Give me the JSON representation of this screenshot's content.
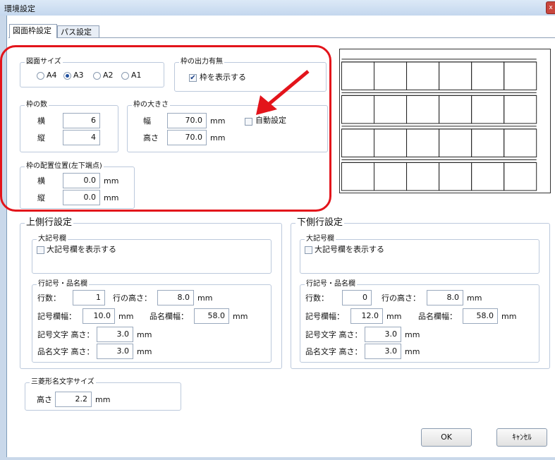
{
  "window": {
    "title": "環境設定",
    "close_label": "x"
  },
  "tabs": [
    {
      "label": "図面枠設定",
      "active": true
    },
    {
      "label": "パス設定",
      "active": false
    }
  ],
  "paper_size": {
    "legend": "図面サイズ",
    "options": [
      "A4",
      "A3",
      "A2",
      "A1"
    ],
    "selected": "A3"
  },
  "frame_output": {
    "legend": "枠の出力有無",
    "checkbox_label": "枠を表示する",
    "checked": true
  },
  "frame_count": {
    "legend": "枠の数",
    "horizontal_label": "横",
    "horizontal_value": "6",
    "vertical_label": "縦",
    "vertical_value": "4"
  },
  "frame_size": {
    "legend": "枠の大きさ",
    "width_label": "幅",
    "width_value": "70.0",
    "height_label": "高さ",
    "height_value": "70.0",
    "unit": "mm",
    "auto_label": "自動設定",
    "auto_checked": false
  },
  "frame_position": {
    "legend": "枠の配置位置(左下端点)",
    "horizontal_label": "横",
    "horizontal_value": "0.0",
    "vertical_label": "縦",
    "vertical_value": "0.0",
    "unit": "mm"
  },
  "upper_rows": {
    "legend": "上側行設定",
    "big_symbol": {
      "legend": "大記号欄",
      "checkbox_label": "大記号欄を表示する",
      "checked": false
    },
    "item": {
      "legend": "行記号・品名欄",
      "rows_label": "行数：",
      "rows_value": "1",
      "row_height_label": "行の高さ：",
      "row_height_value": "8.0",
      "symbol_width_label": "記号欄幅：",
      "symbol_width_value": "10.0",
      "name_width_label": "品名欄幅：",
      "name_width_value": "58.0",
      "symbol_text_label": "記号文字 高さ：",
      "symbol_text_value": "3.0",
      "name_text_label": "品名文字 高さ：",
      "name_text_value": "3.0",
      "unit": "mm"
    }
  },
  "lower_rows": {
    "legend": "下側行設定",
    "big_symbol": {
      "legend": "大記号欄",
      "checkbox_label": "大記号欄を表示する",
      "checked": false
    },
    "item": {
      "legend": "行記号・品名欄",
      "rows_label": "行数：",
      "rows_value": "0",
      "row_height_label": "行の高さ：",
      "row_height_value": "8.0",
      "symbol_width_label": "記号欄幅：",
      "symbol_width_value": "12.0",
      "name_width_label": "品名欄幅：",
      "name_width_value": "58.0",
      "symbol_text_label": "記号文字 高さ：",
      "symbol_text_value": "3.0",
      "name_text_label": "品名文字 高さ：",
      "name_text_value": "3.0",
      "unit": "mm"
    }
  },
  "diamond_text": {
    "legend": "三菱形名文字サイズ",
    "height_label": "高さ",
    "height_value": "2.2",
    "unit": "mm"
  },
  "buttons": {
    "ok": "OK",
    "cancel": "ｷｬﾝｾﾙ"
  },
  "preview": {
    "columns": 6,
    "rows": 4
  },
  "colors": {
    "annotation_red": "#e3141b"
  }
}
